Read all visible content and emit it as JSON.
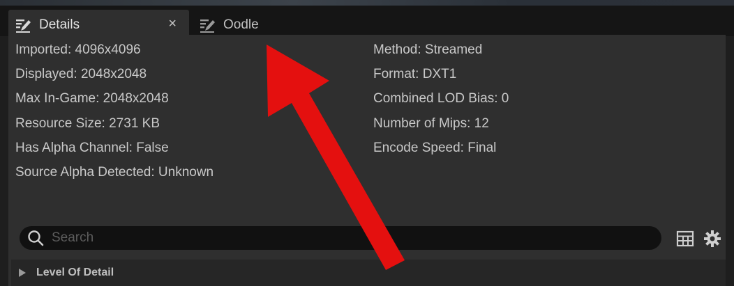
{
  "tabs": [
    {
      "label": "Details",
      "icon": "edit-icon",
      "active": true,
      "close": "×"
    },
    {
      "label": "Oodle",
      "icon": "edit-icon",
      "active": false
    }
  ],
  "info_left": [
    "Imported: 4096x4096",
    "Displayed: 2048x2048",
    "Max In-Game: 2048x2048",
    "Resource Size: 2731 KB",
    "Has Alpha Channel: False",
    "Source Alpha Detected: Unknown"
  ],
  "info_right": [
    "Method: Streamed",
    "Format: DXT1",
    "Combined LOD Bias: 0",
    "Number of Mips: 12",
    "Encode Speed: Final"
  ],
  "search": {
    "placeholder": "Search",
    "icon": "search-icon"
  },
  "toolbar_icons": [
    "table-view-icon",
    "settings-gear-icon"
  ],
  "section": {
    "label": "Level Of Detail",
    "icon": "expand-triangle-icon"
  },
  "annotation": {
    "color": "#e4100f",
    "icon": "red-arrow-annotation"
  }
}
